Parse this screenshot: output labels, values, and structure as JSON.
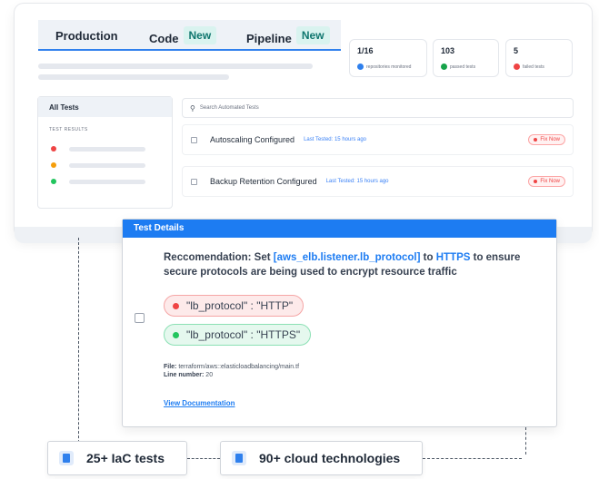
{
  "tabs": [
    {
      "label": "Production"
    },
    {
      "label": "Code",
      "badge": "New"
    },
    {
      "label": "Pipeline",
      "badge": "New"
    }
  ],
  "stats": [
    {
      "value": "1/16",
      "label": "repositories monitored",
      "color": "#2f80ed"
    },
    {
      "value": "103",
      "label": "passed tests",
      "color": "#16a34a"
    },
    {
      "value": "5",
      "label": "failed tests",
      "color": "#ef4444"
    }
  ],
  "sidebar": {
    "title": "All Tests",
    "section": "TEST RESULTS",
    "status_colors": [
      "#ef4444",
      "#f59e0b",
      "#22c55e"
    ]
  },
  "search": {
    "placeholder": "Search Automated Tests"
  },
  "tests": [
    {
      "name": "Autoscaling Configured",
      "last_tested": "Last Tested: 15 hours ago",
      "action": "Fix Now"
    },
    {
      "name": "Backup Retention Configured",
      "last_tested": "Last Tested: 15 hours ago",
      "action": "Fix Now"
    }
  ],
  "detail": {
    "title": "Test Details",
    "reco_prefix": "Reccomendation: Set ",
    "reco_param": "[aws_elb.listener.lb_protocol]",
    "reco_to": " to ",
    "reco_value": "HTTPS",
    "reco_suffix": " to ensure secure protocols are being used to encrypt resource traffic",
    "old_value": "\"lb_protocol\" : \"HTTP\"",
    "new_value": "\"lb_protocol\" : \"HTTPS\"",
    "file_label": "File:",
    "file_path": "terraform/aws::elasticloadbalancing/main.tf",
    "line_label": "Line number:",
    "line_value": "20",
    "doc_link": "View Documentation"
  },
  "chips": [
    {
      "label": "25+ IaC tests"
    },
    {
      "label": "90+ cloud technologies"
    }
  ]
}
